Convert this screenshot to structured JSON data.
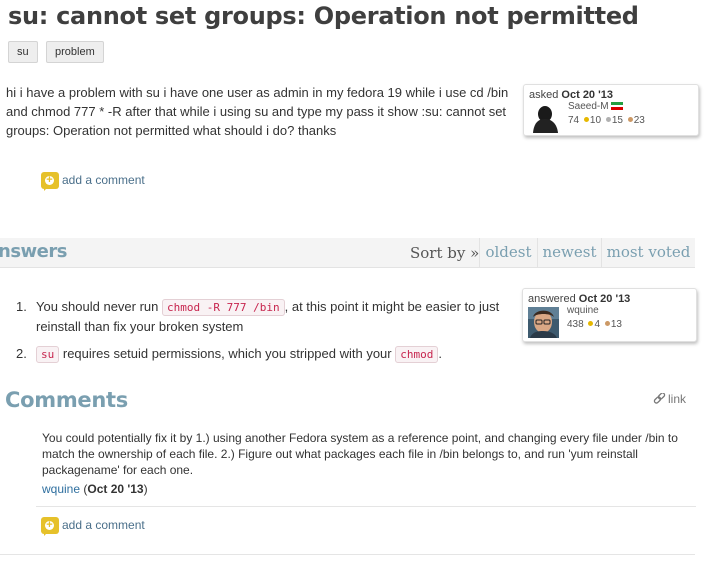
{
  "question": {
    "title": "su: cannot set groups: Operation not permitted",
    "tags": [
      "su",
      "problem"
    ],
    "body": "hi i have a problem with su i have one user as admin in my fedora 19 while i use cd /bin and chmod 777 * -R after that while i using su and type my pass it show :su: cannot set groups: Operation not permitted what should i do? thanks",
    "asked_card": {
      "label": "asked",
      "date": "Oct 20 '13",
      "username": "Saeed-M",
      "karma": "74",
      "gold": "10",
      "silver": "15",
      "bronze": "23"
    },
    "add_comment": "add a comment"
  },
  "answers_bar": {
    "heading": "nswers",
    "sort_label": "Sort by »",
    "tabs": [
      "oldest",
      "newest",
      "most voted"
    ]
  },
  "answer": {
    "items": [
      {
        "number": "1.",
        "pre": "You should never run ",
        "code": "chmod -R 777 /bin",
        "post": ", at this point it might be easier to just reinstall than fix your broken system"
      },
      {
        "number": "2.",
        "code1": "su",
        "mid": " requires setuid permissions, which you stripped with your ",
        "code2": "chmod",
        "post": "."
      }
    ],
    "answered_card": {
      "label": "answered",
      "date": "Oct 20 '13",
      "username": "wquine",
      "karma": "438",
      "gold": "4",
      "bronze": "13"
    }
  },
  "comments": {
    "heading": "Comments",
    "link_label": "link",
    "text": "You could potentially fix it by 1.) using another Fedora system as a reference point, and changing every file under /bin to match the ownership of each file. 2.) Figure out what packages each file in /bin belongs to, and run 'yum reinstall packagename' for each one.",
    "author": "wquine",
    "date": "Oct 20 '13",
    "add_comment": "add a comment"
  },
  "colors": {
    "accent": "#7a9fb0",
    "gold": "#e6b800",
    "silver": "#b0b0b0",
    "bronze": "#cc9966",
    "code": "#c7254e"
  }
}
